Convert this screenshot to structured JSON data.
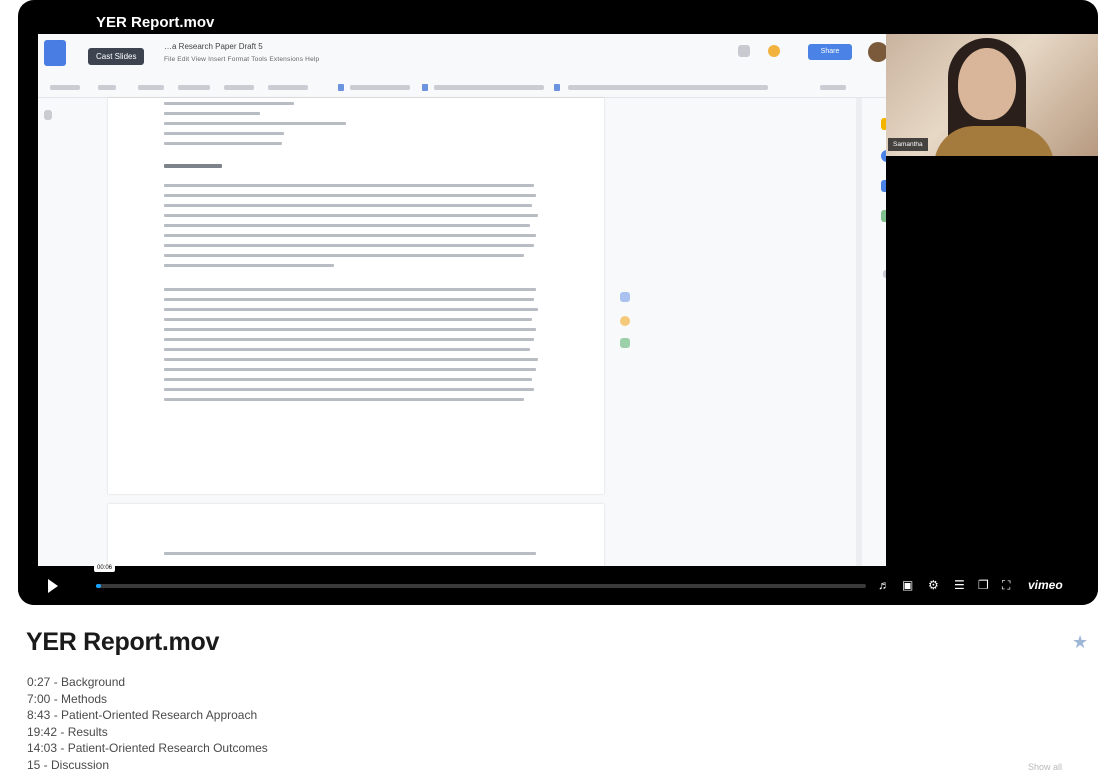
{
  "video": {
    "title": "YER Report.mov",
    "cast_badge": "Cast Slides",
    "doc_name": "…a Research Paper Draft 5",
    "doc_menu": "File   Edit   View   Insert   Format   Tools   Extensions   Help",
    "share_label": "Share",
    "webcam_name": "Samantha",
    "time_tooltip": "00:06",
    "progress_fraction": 0.006,
    "brand": "vimeo",
    "accent_color": "#19a3ff"
  },
  "page": {
    "title": "YER Report.mov",
    "chapters": [
      "0:27 - Background",
      "7:00 - Methods",
      "8:43 - Patient-Oriented Research Approach",
      "19:42 - Results",
      "14:03 - Patient-Oriented Research Outcomes",
      "15 - Discussion"
    ],
    "show_all": "Show all"
  },
  "icons": {
    "play": "play-icon",
    "volume": "volume-icon",
    "captions": "captions-icon",
    "settings": "gear-icon",
    "pip": "picture-in-picture-icon",
    "fullscreen": "fullscreen-icon",
    "star": "star-icon"
  }
}
